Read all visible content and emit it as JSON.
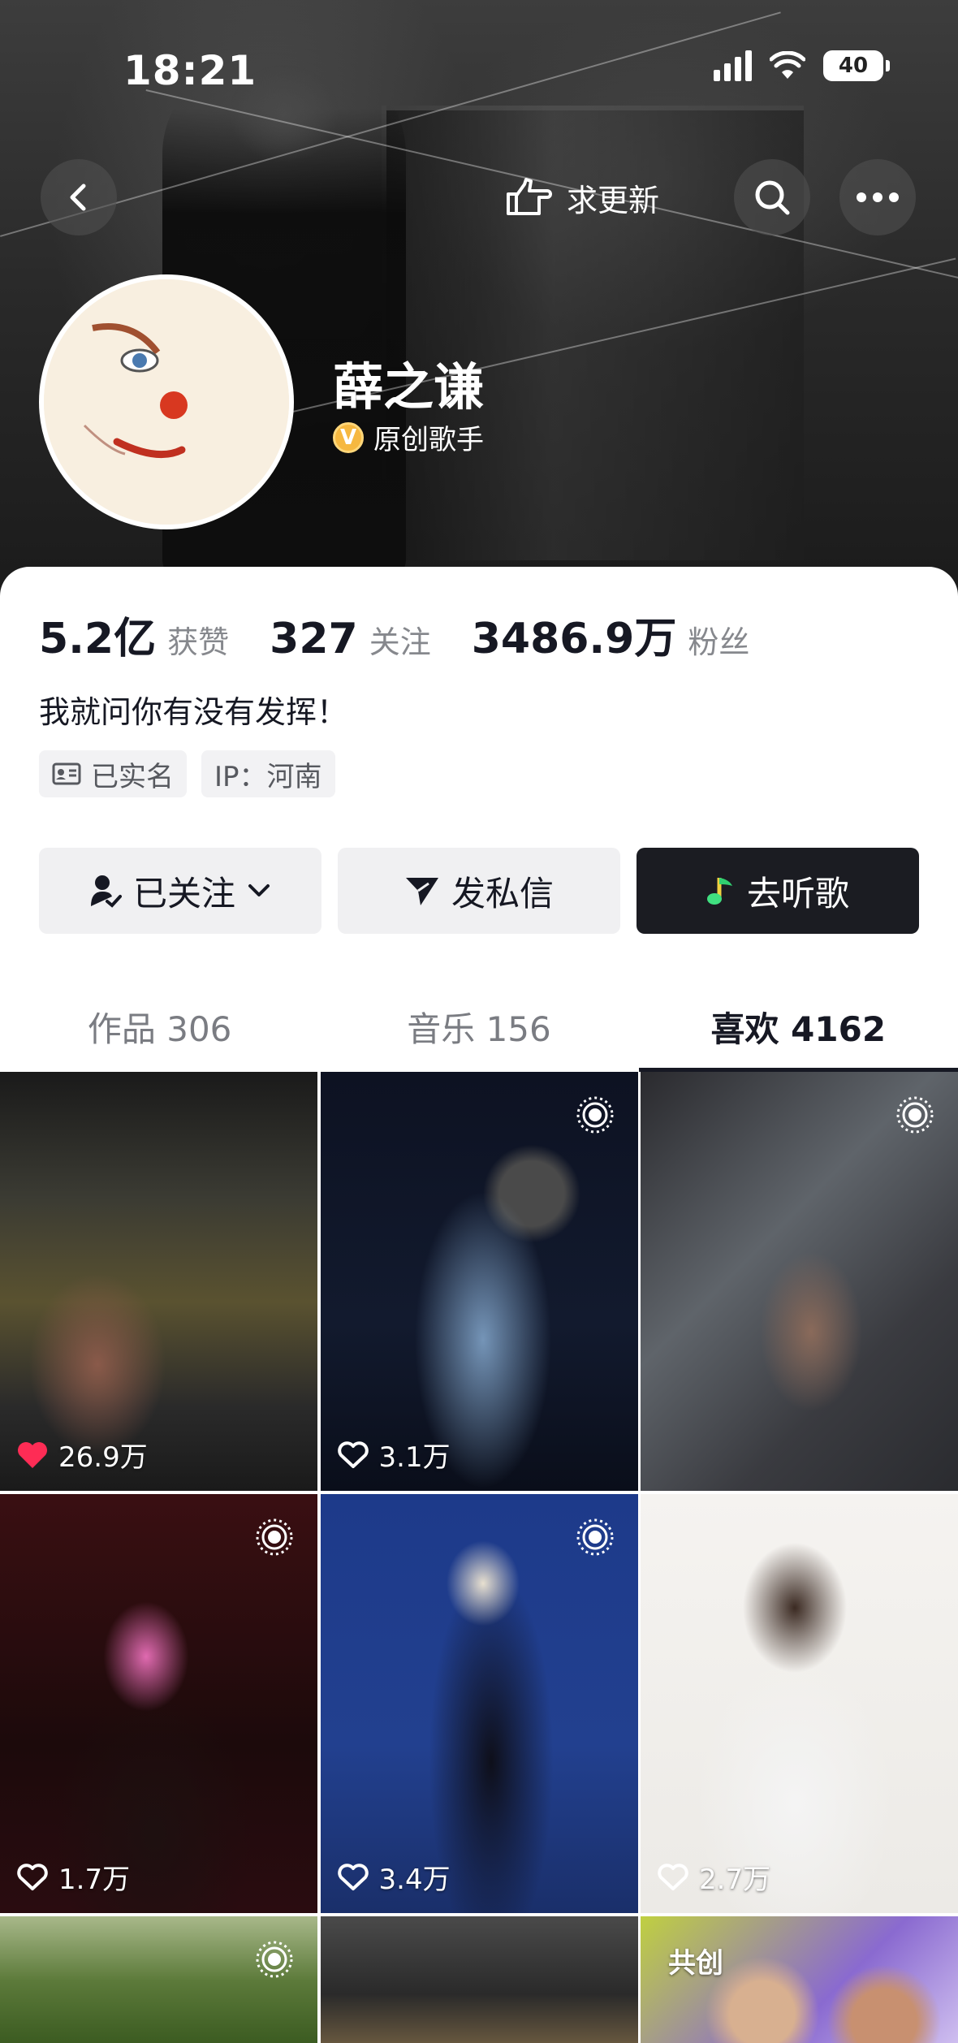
{
  "status_bar": {
    "time": "18:21",
    "battery": "40"
  },
  "header": {
    "update_label": "求更新"
  },
  "profile": {
    "name": "薛之谦",
    "verified_title": "原创歌手",
    "verified_badge": "V",
    "stats": [
      {
        "value": "5.2亿",
        "label": "获赞"
      },
      {
        "value": "327",
        "label": "关注"
      },
      {
        "value": "3486.9万",
        "label": "粉丝"
      }
    ],
    "bio": "我就问你有没有发挥！",
    "tags": {
      "verified_name": "已实名",
      "ip": "IP：河南"
    }
  },
  "actions": {
    "follow": "已关注",
    "message": "发私信",
    "listen": "去听歌"
  },
  "tabs": [
    {
      "label": "作品 306"
    },
    {
      "label": "音乐 156"
    },
    {
      "label": "喜欢 4162"
    }
  ],
  "videos": [
    {
      "likes": "26.9万",
      "liked": true
    },
    {
      "likes": "3.1万",
      "liked": false
    },
    {
      "likes": "",
      "liked": false
    },
    {
      "likes": "1.7万",
      "liked": false
    },
    {
      "likes": "3.4万",
      "liked": false
    },
    {
      "likes": "2.7万",
      "liked": false
    },
    {
      "likes": "",
      "liked": false
    },
    {
      "likes": "",
      "liked": false
    },
    {
      "likes": "",
      "liked": false,
      "badge": "共创"
    }
  ],
  "colors": {
    "accent_dark": "#1b1c22",
    "like_red": "#fe2c55",
    "verified_gold": "#f6b840"
  }
}
